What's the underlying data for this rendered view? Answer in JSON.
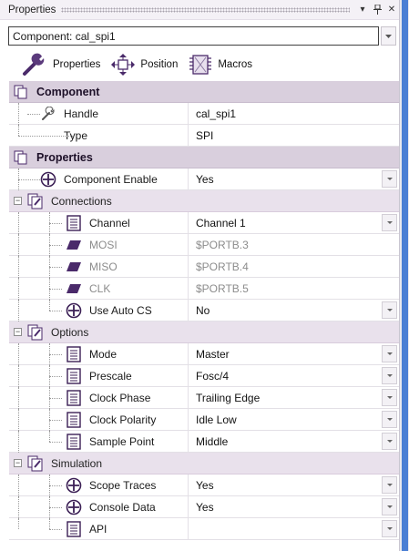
{
  "window": {
    "title": "Properties",
    "pin_glyph": "▾",
    "dock_glyph": "‖",
    "close_glyph": "✕"
  },
  "component_selector": {
    "value": "Component: cal_spi1"
  },
  "tabs": [
    {
      "label": "Properties",
      "icon": "wrench-icon"
    },
    {
      "label": "Position",
      "icon": "move-arrows-icon"
    },
    {
      "label": "Macros",
      "icon": "macro-chip-icon"
    }
  ],
  "groups": {
    "component": {
      "label": "Component",
      "rows": [
        {
          "name": "Handle",
          "value": "cal_spi1"
        },
        {
          "name": "Type",
          "value": "SPI"
        }
      ]
    },
    "properties": {
      "label": "Properties",
      "rows": [
        {
          "name": "Component Enable",
          "value": "Yes"
        }
      ]
    },
    "connections": {
      "label": "Connections",
      "rows": [
        {
          "name": "Channel",
          "value": "Channel 1"
        },
        {
          "name": "MOSI",
          "value": "$PORTB.3"
        },
        {
          "name": "MISO",
          "value": "$PORTB.4"
        },
        {
          "name": "CLK",
          "value": "$PORTB.5"
        },
        {
          "name": "Use Auto CS",
          "value": "No"
        }
      ]
    },
    "options": {
      "label": "Options",
      "rows": [
        {
          "name": "Mode",
          "value": "Master"
        },
        {
          "name": "Prescale",
          "value": "Fosc/4"
        },
        {
          "name": "Clock Phase",
          "value": "Trailing Edge"
        },
        {
          "name": "Clock Polarity",
          "value": "Idle Low"
        },
        {
          "name": "Sample Point",
          "value": "Middle"
        }
      ]
    },
    "simulation": {
      "label": "Simulation",
      "rows": [
        {
          "name": "Scope Traces",
          "value": "Yes"
        },
        {
          "name": "Console Data",
          "value": "Yes"
        },
        {
          "name": "API",
          "value": ""
        }
      ]
    }
  },
  "colors": {
    "group_header": "#d9cfdd",
    "subgroup_header": "#e9e1ec",
    "accent": "#4a2a6a",
    "scrollbar": "#4a7fd4"
  }
}
